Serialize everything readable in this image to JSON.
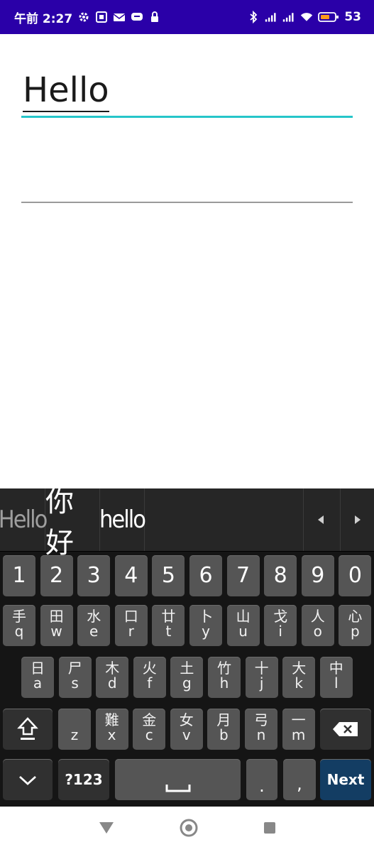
{
  "status_bar": {
    "time": "午前 2:27",
    "battery": "53"
  },
  "fields": {
    "first_value": "Hello",
    "second_value": ""
  },
  "keyboard": {
    "suggestions": [
      "Hello",
      "你好",
      "hello"
    ],
    "number_row": [
      "1",
      "2",
      "3",
      "4",
      "5",
      "6",
      "7",
      "8",
      "9",
      "0"
    ],
    "row1": [
      {
        "top": "手",
        "bot": "q"
      },
      {
        "top": "田",
        "bot": "w"
      },
      {
        "top": "水",
        "bot": "e"
      },
      {
        "top": "口",
        "bot": "r"
      },
      {
        "top": "廿",
        "bot": "t"
      },
      {
        "top": "卜",
        "bot": "y"
      },
      {
        "top": "山",
        "bot": "u"
      },
      {
        "top": "戈",
        "bot": "i"
      },
      {
        "top": "人",
        "bot": "o"
      },
      {
        "top": "心",
        "bot": "p"
      }
    ],
    "row2": [
      {
        "top": "日",
        "bot": "a"
      },
      {
        "top": "尸",
        "bot": "s"
      },
      {
        "top": "木",
        "bot": "d"
      },
      {
        "top": "火",
        "bot": "f"
      },
      {
        "top": "土",
        "bot": "g"
      },
      {
        "top": "竹",
        "bot": "h"
      },
      {
        "top": "十",
        "bot": "j"
      },
      {
        "top": "大",
        "bot": "k"
      },
      {
        "top": "中",
        "bot": "l"
      }
    ],
    "row3": [
      {
        "top": "",
        "bot": "z"
      },
      {
        "top": "難",
        "bot": "x"
      },
      {
        "top": "金",
        "bot": "c"
      },
      {
        "top": "女",
        "bot": "v"
      },
      {
        "top": "月",
        "bot": "b"
      },
      {
        "top": "弓",
        "bot": "n"
      },
      {
        "top": "一",
        "bot": "m"
      }
    ],
    "symbols_label": "?123",
    "period_label": ".",
    "comma_label": ",",
    "next_label": "Next"
  }
}
